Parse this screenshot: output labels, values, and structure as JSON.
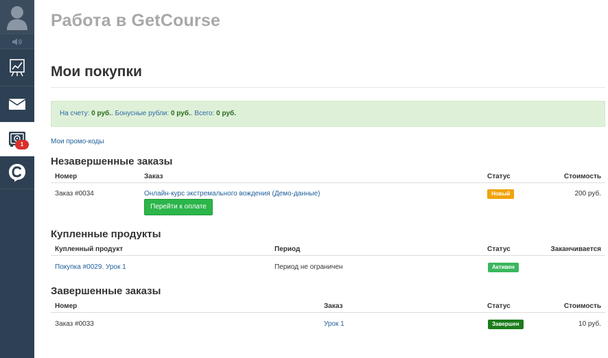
{
  "brand": "Работа в GetCourse",
  "page_title": "Мои покупки",
  "balance": {
    "account_label": "На счету:",
    "account_value": "0 руб.",
    "bonus_label": ". Бонусные рубли:",
    "bonus_value": "0 руб.",
    "total_label": ". Всего:",
    "total_value": "0 руб."
  },
  "promo_link": "Мои промо-коды",
  "sidebar": {
    "purchases_badge": "1",
    "colors": {
      "bg": "#2e4053",
      "active_bg": "#ffffff",
      "badge": "#d9302c"
    },
    "icons": [
      "user-avatar-icon",
      "speaker-icon",
      "chart-board-icon",
      "envelope-icon",
      "safe-icon",
      "getcourse-logo-icon"
    ]
  },
  "unfinished": {
    "title": "Незавершенные заказы",
    "headers": {
      "number": "Номер",
      "order": "Заказ",
      "status": "Статус",
      "cost": "Стоимость"
    },
    "rows": [
      {
        "number": "Заказ #0034",
        "order": "Онлайн-курс экстремального вождения (Демо-данные)",
        "status": "Новый",
        "cost": "200 руб.",
        "pay_button": "Перейти к оплате"
      }
    ]
  },
  "purchased": {
    "title": "Купленные продукты",
    "headers": {
      "product": "Купленный продукт",
      "period": "Период",
      "status": "Статус",
      "ends": "Заканчивается"
    },
    "rows": [
      {
        "product": "Покупка #0029. Урок 1",
        "period": "Период не ограничен",
        "status": "Активен",
        "ends": ""
      }
    ]
  },
  "finished": {
    "title": "Завершенные заказы",
    "headers": {
      "number": "Номер",
      "order": "Заказ",
      "status": "Статус",
      "cost": "Стоимость"
    },
    "rows": [
      {
        "number": "Заказ #0033",
        "order": "Урок 1",
        "status": "Завершен",
        "cost": "10 руб."
      }
    ]
  }
}
